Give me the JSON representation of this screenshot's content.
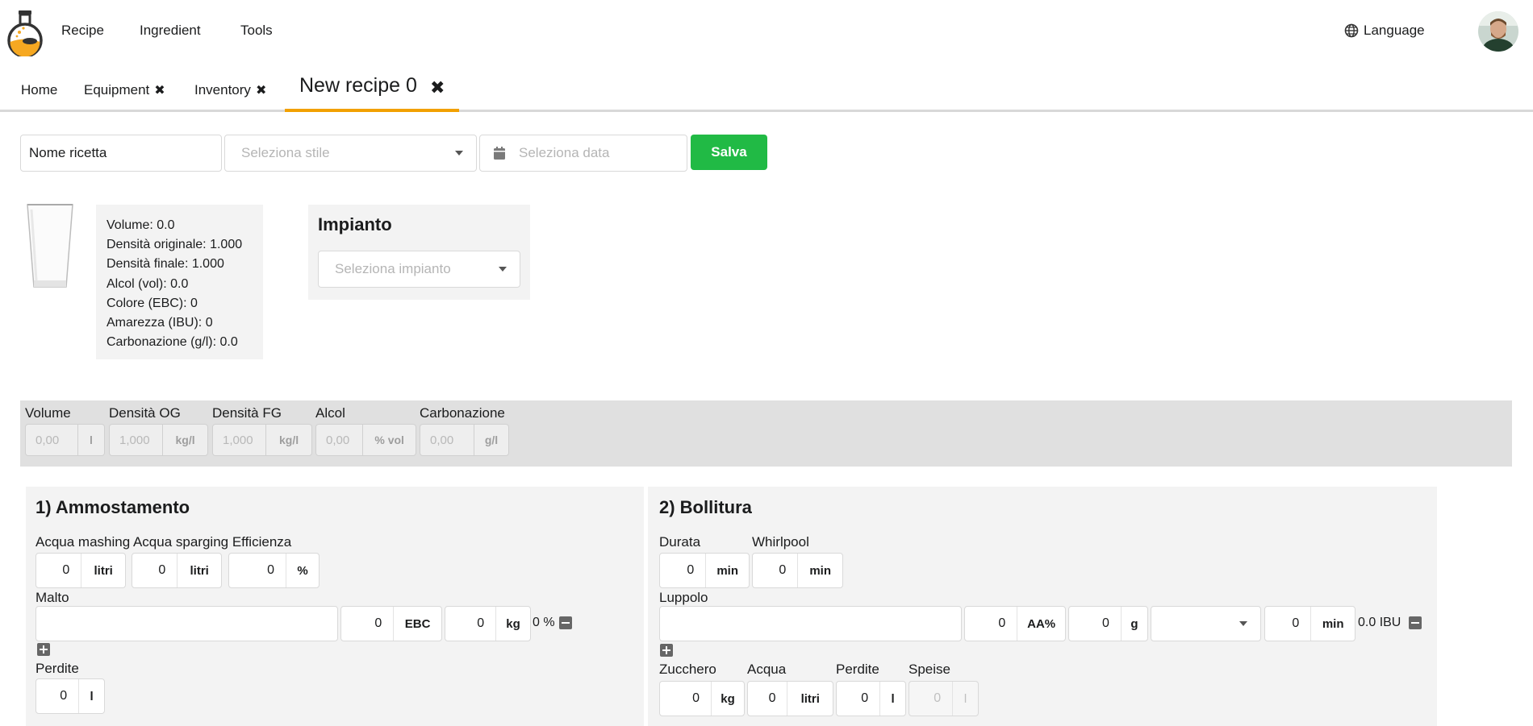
{
  "nav": {
    "items": [
      "Recipe",
      "Ingredient",
      "Tools"
    ],
    "language": "Language"
  },
  "tabs": {
    "home": "Home",
    "equipment": "Equipment",
    "inventory": "Inventory",
    "active": "New recipe 0",
    "close_glyph": "✖"
  },
  "form": {
    "name_value": "Nome ricetta",
    "style_placeholder": "Seleziona stile",
    "date_placeholder": "Seleziona data",
    "save_label": "Salva"
  },
  "stats": [
    "Volume: 0.0",
    "Densità originale: 1.000",
    "Densità finale: 1.000",
    "Alcol (vol): 0.0",
    "Colore (EBC): 0",
    "Amarezza (IBU): 0",
    "Carbonazione (g/l): 0.0"
  ],
  "impianto": {
    "title": "Impianto",
    "placeholder": "Seleziona impianto"
  },
  "params": [
    {
      "label": "Volume",
      "value": "0,00",
      "unit": "l"
    },
    {
      "label": "Densità OG",
      "value": "1,000",
      "unit": "kg/l"
    },
    {
      "label": "Densità FG",
      "value": "1,000",
      "unit": "kg/l"
    },
    {
      "label": "Alcol",
      "value": "0,00",
      "unit": "% vol"
    },
    {
      "label": "Carbonazione",
      "value": "0,00",
      "unit": "g/l"
    }
  ],
  "mash": {
    "title": "1) Ammostamento",
    "labels": "Acqua mashing Acqua sparging Efficienza",
    "mashing": {
      "value": "0",
      "unit": "litri"
    },
    "sparging": {
      "value": "0",
      "unit": "litri"
    },
    "efficiency": {
      "value": "0",
      "unit": "%"
    },
    "malt_label": "Malto",
    "malt_ebc": {
      "value": "0",
      "unit": "EBC"
    },
    "malt_kg": {
      "value": "0",
      "unit": "kg"
    },
    "malt_percent": "0 %",
    "losses_label": "Perdite",
    "losses": {
      "value": "0",
      "unit": "l"
    }
  },
  "boil": {
    "title": "2) Bollitura",
    "duration_label": "Durata",
    "duration": {
      "value": "0",
      "unit": "min"
    },
    "whirlpool_label": "Whirlpool",
    "whirlpool": {
      "value": "0",
      "unit": "min"
    },
    "hops_label": "Luppolo",
    "hops_aa": {
      "value": "0",
      "unit": "AA%"
    },
    "hops_g": {
      "value": "0",
      "unit": "g"
    },
    "hops_time": {
      "value": "0",
      "unit": "min"
    },
    "hops_ibu": "0.0 IBU",
    "sugar_label": "Zucchero",
    "sugar": {
      "value": "0",
      "unit": "kg"
    },
    "water_label": "Acqua",
    "water": {
      "value": "0",
      "unit": "litri"
    },
    "losses_label": "Perdite",
    "losses": {
      "value": "0",
      "unit": "l"
    },
    "speise_label": "Speise",
    "speise": {
      "value": "0",
      "unit": "l"
    }
  }
}
